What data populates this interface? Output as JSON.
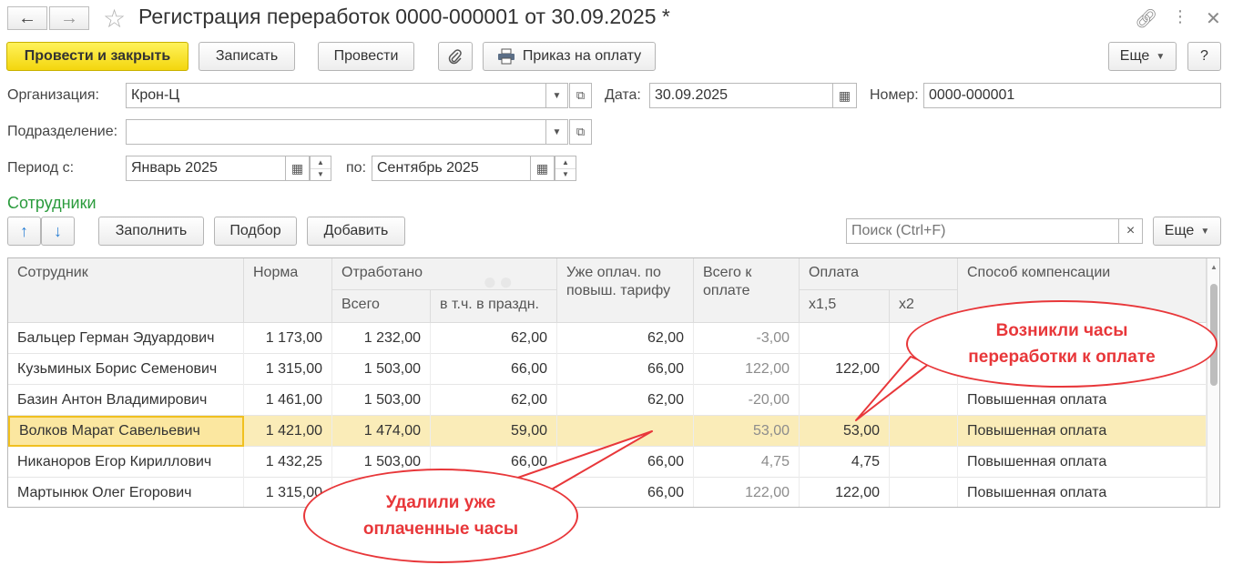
{
  "window": {
    "title": "Регистрация переработок 0000-000001 от 30.09.2025 *",
    "back_icon": "arrow-left-icon",
    "forward_icon": "arrow-right-icon",
    "star_icon": "star-icon",
    "link_icon": "link-icon",
    "menu_icon": "more-vertical-icon",
    "close_icon": "close-icon"
  },
  "toolbar": {
    "post_close_label": "Провести и закрыть",
    "save_label": "Записать",
    "post_label": "Провести",
    "attach_icon": "paperclip-icon",
    "print_icon": "printer-icon",
    "print_label": "Приказ на оплату",
    "more_label": "Еще",
    "help_label": "?"
  },
  "form": {
    "org_label": "Организация:",
    "org_value": "Крон-Ц",
    "date_label": "Дата:",
    "date_value": "30.09.2025",
    "number_label": "Номер:",
    "number_value": "0000-000001",
    "dept_label": "Подразделение:",
    "dept_value": "",
    "period_label": "Период с:",
    "period_from": "Январь 2025",
    "period_to_label": "по:",
    "period_to": "Сентябрь 2025"
  },
  "employees": {
    "section_title": "Сотрудники",
    "up_icon": "arrow-up-icon",
    "down_icon": "arrow-down-icon",
    "fill_label": "Заполнить",
    "pick_label": "Подбор",
    "add_label": "Добавить",
    "search_placeholder": "Поиск (Ctrl+F)",
    "search_clear": "×",
    "more_label": "Еще"
  },
  "table": {
    "headers": {
      "employee": "Сотрудник",
      "norm": "Норма",
      "worked": "Отработано",
      "worked_total": "Всего",
      "worked_holiday": "в т.ч. в праздн.",
      "already_paid": "Уже оплач. по повыш. тарифу",
      "total_to_pay": "Всего к оплате",
      "payment": "Оплата",
      "x15": "х1,5",
      "x2": "х2",
      "compensation": "Способ компенсации"
    },
    "rows": [
      {
        "employee": "Бальцер Герман Эдуардович",
        "norm": "1 173,00",
        "worked": "1 232,00",
        "holiday": "62,00",
        "paid": "62,00",
        "total": "-3,00",
        "x15": "",
        "x2": "",
        "method": ""
      },
      {
        "employee": "Кузьминых Борис Семенович",
        "norm": "1 315,00",
        "worked": "1 503,00",
        "holiday": "66,00",
        "paid": "66,00",
        "total": "122,00",
        "x15": "122,00",
        "x2": "",
        "method": ""
      },
      {
        "employee": "Базин Антон Владимирович",
        "norm": "1 461,00",
        "worked": "1 503,00",
        "holiday": "62,00",
        "paid": "62,00",
        "total": "-20,00",
        "x15": "",
        "x2": "",
        "method": "Повышенная оплата"
      },
      {
        "employee": "Волков Марат Савельевич",
        "norm": "1 421,00",
        "worked": "1 474,00",
        "holiday": "59,00",
        "paid": "",
        "total": "53,00",
        "x15": "53,00",
        "x2": "",
        "method": "Повышенная оплата"
      },
      {
        "employee": "Никаноров Егор Кириллович",
        "norm": "1 432,25",
        "worked": "1 503,00",
        "holiday": "66,00",
        "paid": "66,00",
        "total": "4,75",
        "x15": "4,75",
        "x2": "",
        "method": "Повышенная оплата"
      },
      {
        "employee": "Мартынюк Олег Егорович",
        "norm": "1 315,00",
        "worked": "",
        "holiday": "",
        "paid": "66,00",
        "total": "122,00",
        "x15": "122,00",
        "x2": "",
        "method": "Повышенная оплата"
      }
    ]
  },
  "callouts": {
    "overtime": "Возникли часы переработки к оплате",
    "deleted": "Удалили уже оплаченные часы"
  },
  "colors": {
    "primary_button": "#f3d60e",
    "selected_row": "#faecb8",
    "section_title": "#2a9b3c",
    "callout": "#e8373a"
  }
}
